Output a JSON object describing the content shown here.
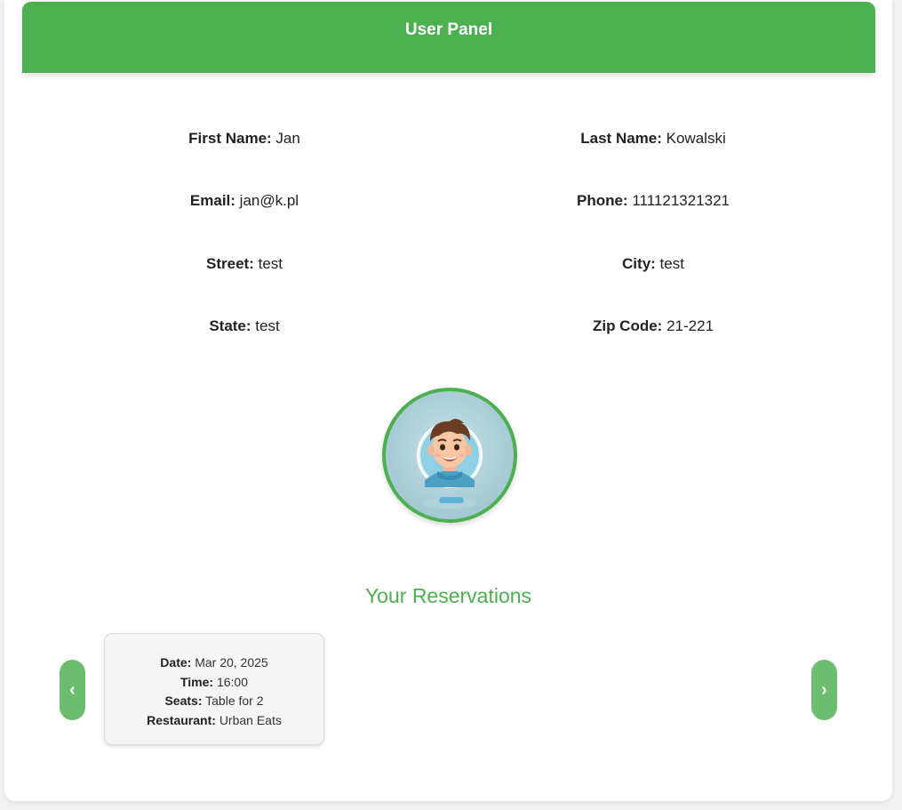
{
  "header": {
    "title": "User Panel"
  },
  "profile": {
    "first_name": {
      "label": "First Name:",
      "value": "Jan"
    },
    "last_name": {
      "label": "Last Name:",
      "value": "Kowalski"
    },
    "email": {
      "label": "Email:",
      "value": "jan@k.pl"
    },
    "phone": {
      "label": "Phone:",
      "value": "111121321321"
    },
    "street": {
      "label": "Street:",
      "value": "test"
    },
    "city": {
      "label": "City:",
      "value": "test"
    },
    "state": {
      "label": "State:",
      "value": "test"
    },
    "zip": {
      "label": "Zip Code:",
      "value": "21-221"
    }
  },
  "avatar": {
    "icon": "avatar-illustration"
  },
  "reservations": {
    "title": "Your Reservations",
    "prev_label": "‹",
    "next_label": "›",
    "items": [
      {
        "date_label": "Date:",
        "date": "Mar 20, 2025",
        "time_label": "Time:",
        "time": "16:00",
        "seats_label": "Seats:",
        "seats": "Table for 2",
        "restaurant_label": "Restaurant:",
        "restaurant": "Urban Eats"
      }
    ]
  },
  "colors": {
    "accent": "#4caf50",
    "nav_button": "#6dbd70",
    "card_bg": "#f5f5f5"
  }
}
